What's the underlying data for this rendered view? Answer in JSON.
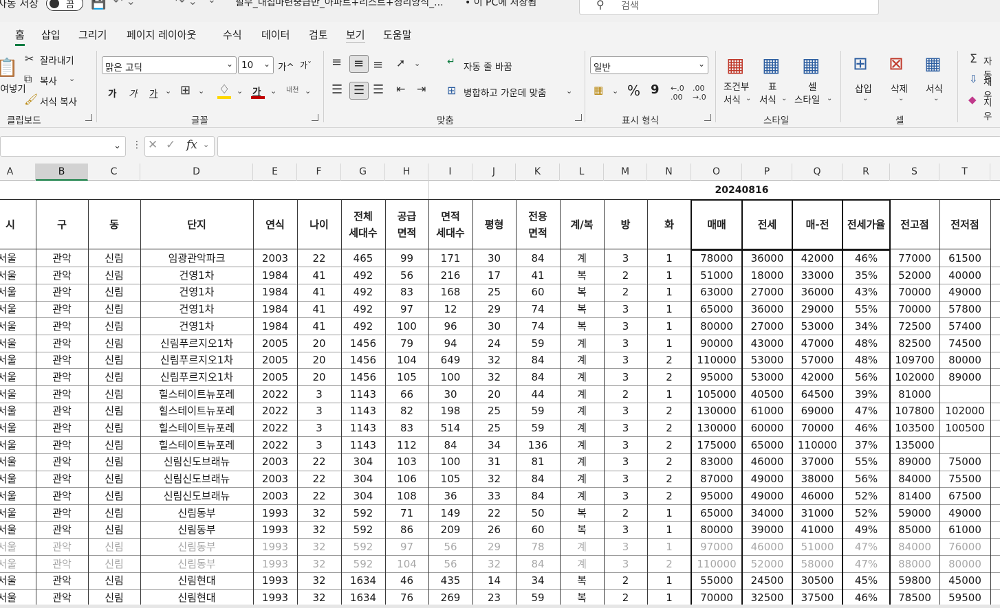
{
  "titlebar": {
    "autosave_label": "자동 저장",
    "toggle_label": "끔",
    "file_title": "필무_내집마련중급반_아파트+리스트+정리양식_...",
    "save_status": "• 이 PC에 저장됨",
    "search_placeholder": "검색"
  },
  "menu_tabs": [
    "홈",
    "삽입",
    "그리기",
    "페이지 레이아웃",
    "수식",
    "데이터",
    "검토",
    "보기",
    "도움말"
  ],
  "ribbon": {
    "paste": "붙여넣기",
    "cut": "잘라내기",
    "copy": "복사",
    "format_painter": "서식 복사",
    "clipboard_group": "클립보드",
    "font_name": "맑은 고딕",
    "font_size": "10",
    "font_group": "글꼴",
    "bold": "가",
    "italic": "가",
    "underline": "가",
    "increase_font": "가^",
    "decrease_font": "가ˇ",
    "phonetic": "내천",
    "wrap_text": "자동 줄 바꿈",
    "merge_center": "병합하고 가운데 맞춤",
    "alignment_group": "맞춤",
    "number_format": "일반",
    "percent": "%",
    "comma": "9",
    "number_group": "표시 형식",
    "cond_format_1": "조건부",
    "cond_format_2": "서식",
    "table_1": "표",
    "table_2": "서식",
    "cell_style_1": "셀",
    "cell_style_2": "스타일",
    "styles_group": "스타일",
    "insert": "삽입",
    "delete": "삭제",
    "format": "서식",
    "cells_group": "셀",
    "autosum": "자동",
    "fill": "채우",
    "clear": "지우"
  },
  "formula_bar": {
    "fx": "fx",
    "value": ""
  },
  "columns": [
    "A",
    "B",
    "C",
    "D",
    "E",
    "F",
    "G",
    "H",
    "I",
    "J",
    "K",
    "L",
    "M",
    "N",
    "O",
    "P",
    "Q",
    "R",
    "S",
    "T"
  ],
  "date_header": "20240816",
  "table_headers": [
    "시",
    "구",
    "동",
    "단지",
    "연식",
    "나이",
    "전체\n세대수",
    "공급\n면적",
    "면적\n세대수",
    "평형",
    "전용\n면적",
    "계/복",
    "방",
    "화",
    "매매",
    "전세",
    "매-전",
    "전세가율",
    "전고점",
    "전저점"
  ],
  "rows": [
    {
      "dim": false,
      "cells": [
        "서울",
        "관악",
        "신림",
        "임광관악파크",
        "2003",
        "22",
        "465",
        "99",
        "171",
        "30",
        "84",
        "계",
        "3",
        "1",
        "78000",
        "36000",
        "42000",
        "46%",
        "77000",
        "61500"
      ]
    },
    {
      "dim": false,
      "cells": [
        "서울",
        "관악",
        "신림",
        "건영1차",
        "1984",
        "41",
        "492",
        "56",
        "216",
        "17",
        "41",
        "복",
        "2",
        "1",
        "51000",
        "18000",
        "33000",
        "35%",
        "52000",
        "40000"
      ]
    },
    {
      "dim": false,
      "cells": [
        "서울",
        "관악",
        "신림",
        "건영1차",
        "1984",
        "41",
        "492",
        "83",
        "168",
        "25",
        "60",
        "복",
        "2",
        "1",
        "63000",
        "27000",
        "36000",
        "43%",
        "70000",
        "49000"
      ]
    },
    {
      "dim": false,
      "cells": [
        "서울",
        "관악",
        "신림",
        "건영1차",
        "1984",
        "41",
        "492",
        "97",
        "12",
        "29",
        "74",
        "복",
        "3",
        "1",
        "65000",
        "36000",
        "29000",
        "55%",
        "70000",
        "57800"
      ]
    },
    {
      "dim": false,
      "cells": [
        "서울",
        "관악",
        "신림",
        "건영1차",
        "1984",
        "41",
        "492",
        "100",
        "96",
        "30",
        "74",
        "복",
        "3",
        "1",
        "80000",
        "27000",
        "53000",
        "34%",
        "72500",
        "57400"
      ]
    },
    {
      "dim": false,
      "cells": [
        "서울",
        "관악",
        "신림",
        "신림푸르지오1차",
        "2005",
        "20",
        "1456",
        "79",
        "94",
        "24",
        "59",
        "계",
        "3",
        "1",
        "90000",
        "43000",
        "47000",
        "48%",
        "82500",
        "74500"
      ]
    },
    {
      "dim": false,
      "cells": [
        "서울",
        "관악",
        "신림",
        "신림푸르지오1차",
        "2005",
        "20",
        "1456",
        "104",
        "649",
        "32",
        "84",
        "계",
        "3",
        "2",
        "110000",
        "53000",
        "57000",
        "48%",
        "109700",
        "80000"
      ]
    },
    {
      "dim": false,
      "cells": [
        "서울",
        "관악",
        "신림",
        "신림푸르지오1차",
        "2005",
        "20",
        "1456",
        "105",
        "100",
        "32",
        "84",
        "계",
        "3",
        "2",
        "95000",
        "53000",
        "42000",
        "56%",
        "102000",
        "89000"
      ]
    },
    {
      "dim": false,
      "cells": [
        "서울",
        "관악",
        "신림",
        "힐스테이트뉴포레",
        "2022",
        "3",
        "1143",
        "66",
        "30",
        "20",
        "44",
        "계",
        "2",
        "1",
        "105000",
        "40500",
        "64500",
        "39%",
        "81000",
        ""
      ]
    },
    {
      "dim": false,
      "cells": [
        "서울",
        "관악",
        "신림",
        "힐스테이트뉴포레",
        "2022",
        "3",
        "1143",
        "82",
        "198",
        "25",
        "59",
        "계",
        "3",
        "2",
        "130000",
        "61000",
        "69000",
        "47%",
        "107800",
        "102000"
      ]
    },
    {
      "dim": false,
      "cells": [
        "서울",
        "관악",
        "신림",
        "힐스테이트뉴포레",
        "2022",
        "3",
        "1143",
        "83",
        "514",
        "25",
        "59",
        "계",
        "3",
        "2",
        "130000",
        "60000",
        "70000",
        "46%",
        "103500",
        "100500"
      ]
    },
    {
      "dim": false,
      "cells": [
        "서울",
        "관악",
        "신림",
        "힐스테이트뉴포레",
        "2022",
        "3",
        "1143",
        "112",
        "84",
        "34",
        "136",
        "계",
        "3",
        "2",
        "175000",
        "65000",
        "110000",
        "37%",
        "135000",
        ""
      ]
    },
    {
      "dim": false,
      "cells": [
        "서울",
        "관악",
        "신림",
        "신림신도브래뉴",
        "2003",
        "22",
        "304",
        "103",
        "100",
        "31",
        "81",
        "계",
        "3",
        "2",
        "83000",
        "46000",
        "37000",
        "55%",
        "89000",
        "75000"
      ]
    },
    {
      "dim": false,
      "cells": [
        "서울",
        "관악",
        "신림",
        "신림신도브래뉴",
        "2003",
        "22",
        "304",
        "106",
        "105",
        "32",
        "84",
        "계",
        "3",
        "2",
        "87000",
        "49000",
        "38000",
        "56%",
        "84000",
        "75500"
      ]
    },
    {
      "dim": false,
      "cells": [
        "서울",
        "관악",
        "신림",
        "신림신도브래뉴",
        "2003",
        "22",
        "304",
        "108",
        "36",
        "33",
        "84",
        "계",
        "3",
        "2",
        "95000",
        "49000",
        "46000",
        "52%",
        "81400",
        "67500"
      ]
    },
    {
      "dim": false,
      "cells": [
        "서울",
        "관악",
        "신림",
        "신림동부",
        "1993",
        "32",
        "592",
        "71",
        "149",
        "22",
        "50",
        "복",
        "2",
        "1",
        "65000",
        "34000",
        "31000",
        "52%",
        "59000",
        "49000"
      ]
    },
    {
      "dim": false,
      "cells": [
        "서울",
        "관악",
        "신림",
        "신림동부",
        "1993",
        "32",
        "592",
        "86",
        "209",
        "26",
        "60",
        "복",
        "3",
        "1",
        "80000",
        "39000",
        "41000",
        "49%",
        "85000",
        "61000"
      ]
    },
    {
      "dim": true,
      "cells": [
        "서울",
        "관악",
        "신림",
        "신림동부",
        "1993",
        "32",
        "592",
        "97",
        "56",
        "29",
        "78",
        "계",
        "3",
        "1",
        "97000",
        "46000",
        "51000",
        "47%",
        "84000",
        "76000"
      ]
    },
    {
      "dim": true,
      "cells": [
        "서울",
        "관악",
        "신림",
        "신림동부",
        "1993",
        "32",
        "592",
        "104",
        "56",
        "32",
        "84",
        "계",
        "3",
        "2",
        "110000",
        "52000",
        "58000",
        "47%",
        "88000",
        "80000"
      ]
    },
    {
      "dim": false,
      "cells": [
        "서울",
        "관악",
        "신림",
        "신림현대",
        "1993",
        "32",
        "1634",
        "46",
        "435",
        "14",
        "34",
        "복",
        "2",
        "1",
        "55000",
        "24500",
        "30500",
        "45%",
        "59800",
        "45000"
      ]
    },
    {
      "dim": false,
      "cells": [
        "서울",
        "관악",
        "신림",
        "신림현대",
        "1993",
        "32",
        "1634",
        "76",
        "269",
        "23",
        "59",
        "복",
        "2",
        "1",
        "70000",
        "32500",
        "37500",
        "46%",
        "78500",
        "59500"
      ]
    }
  ],
  "colors": {
    "accent": "#107c41",
    "ribbon_bg": "#f3f3f3",
    "dim_text": "#a8a8a8"
  }
}
